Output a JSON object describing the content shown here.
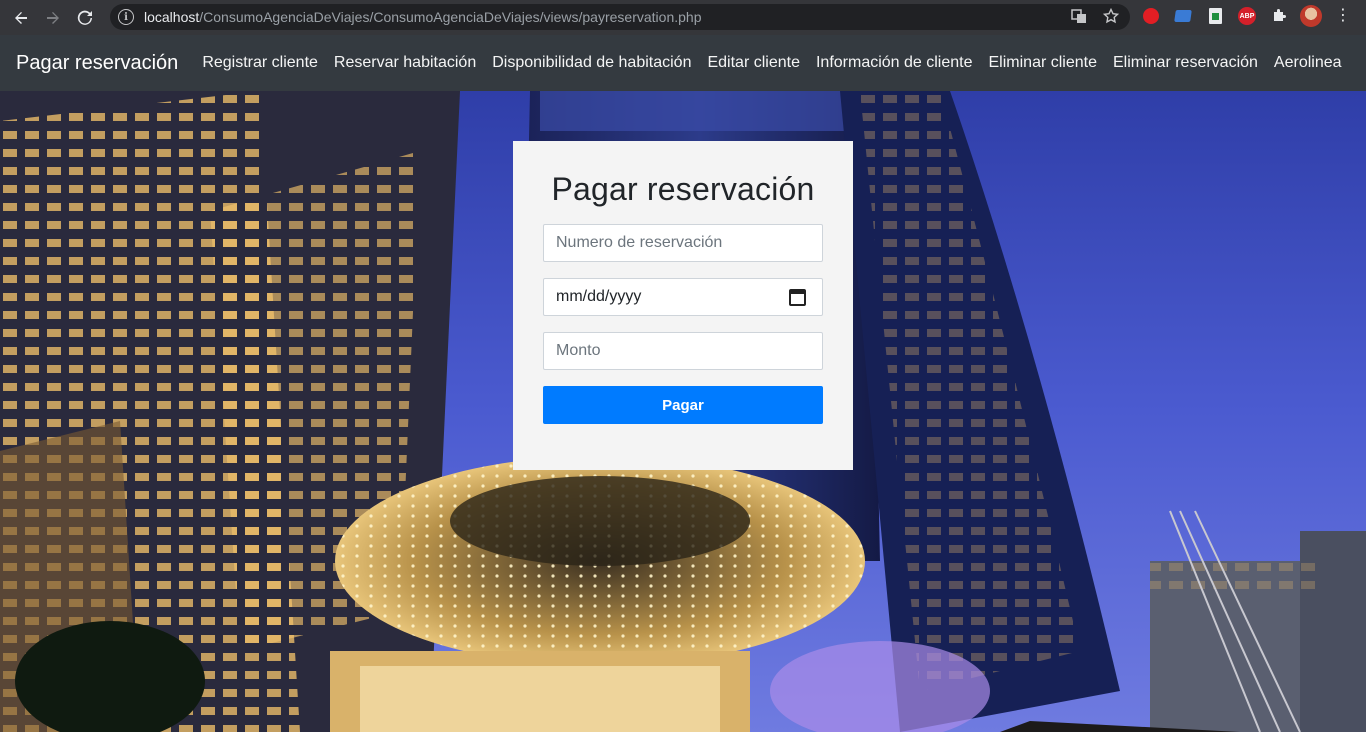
{
  "browser": {
    "url_host": "localhost",
    "url_path": "/ConsumoAgenciaDeViajes/ConsumoAgenciaDeViajes/views/payreservation.php",
    "abp_label": "ABP"
  },
  "navbar": {
    "brand": "Pagar reservación",
    "links": [
      "Registrar cliente",
      "Reservar habitación",
      "Disponibilidad de habitación",
      "Editar cliente",
      "Información de cliente",
      "Eliminar cliente",
      "Eliminar reservación",
      "Aerolinea"
    ]
  },
  "form": {
    "title": "Pagar reservación",
    "reservation_placeholder": "Numero de reservación",
    "date_placeholder": "mm/dd/yyyy",
    "amount_placeholder": "Monto",
    "submit_label": "Pagar"
  },
  "colors": {
    "navbar": "#343a40",
    "primary": "#007bff",
    "card": "#f4f4f4"
  }
}
